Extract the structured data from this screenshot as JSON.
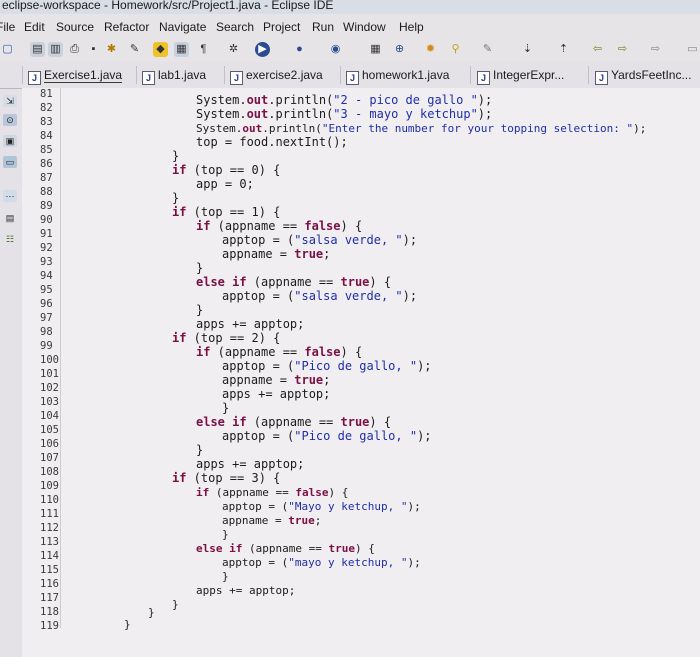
{
  "window": {
    "title": "eclipse-workspace - Homework/src/Project1.java - Eclipse IDE"
  },
  "menu": [
    "File",
    "Edit",
    "Source",
    "Refactor",
    "Navigate",
    "Search",
    "Project",
    "Run",
    "Window",
    "Help"
  ],
  "tabs": [
    {
      "label": "Exercise1.java"
    },
    {
      "label": "lab1.java"
    },
    {
      "label": "exercise2.java"
    },
    {
      "label": "homework1.java"
    },
    {
      "label": "IntegerExpr..."
    },
    {
      "label": "YardsFeetInc..."
    }
  ],
  "line_numbers": [
    "81",
    "82",
    "83",
    "84",
    "85",
    "86",
    "87",
    "88",
    "89",
    "90",
    "91",
    "92",
    "93",
    "94",
    "95",
    "96",
    "97",
    "98",
    "99",
    "100",
    "101",
    "102",
    "103",
    "104",
    "105",
    "106",
    "107",
    "108",
    "109",
    "110",
    "111",
    "112",
    "113",
    "114",
    "115",
    "116",
    "117",
    "118",
    "119"
  ],
  "code": {
    "l1a": "System.",
    "l1b": "out",
    "l1c": ".println(",
    "l1s": "\"2 - pico de gallo \"",
    "l1d": ");",
    "l2a": "System.",
    "l2b": "out",
    "l2c": ".println(",
    "l2s": "\"3 - mayo y ketchup\"",
    "l2d": ");",
    "l3a": "System.",
    "l3b": "out",
    "l3c": ".println(",
    "l3s": "\"Enter the number for your topping selection: \"",
    "l3d": ");",
    "l4": "top = food.nextInt();",
    "l5": "}",
    "l6k": "if",
    "l6": " (top == 0) {",
    "l7": "app = 0;",
    "l8": "}",
    "l9k": "if",
    "l9": " (top == 1) {",
    "l10k": "if",
    "l10": " (appname == ",
    "l10b": "false",
    "l10c": ") {",
    "l11a": "apptop = (",
    "l11s": "\"salsa verde, \"",
    "l11b": ");",
    "l12a": "appname = ",
    "l12b": "true",
    "l12c": ";",
    "l13": "}",
    "l14k": "else if",
    "l14": " (appname == ",
    "l14b": "true",
    "l14c": ") {",
    "l15a": "apptop = (",
    "l15s": "\"salsa verde, \"",
    "l15b": ");",
    "l16": "}",
    "l17": "apps += apptop;",
    "l18k": "if",
    "l18": " (top == 2) {",
    "l19k": "if",
    "l19": " (appname == ",
    "l19b": "false",
    "l19c": ") {",
    "l20a": "apptop = (",
    "l20s": "\"Pico de gallo, \"",
    "l20b": ");",
    "l21a": "appname = ",
    "l21b": "true",
    "l21c": ";",
    "l22": "apps += apptop;",
    "l23": "}",
    "l24k": "else if",
    "l24": " (appname == ",
    "l24b": "true",
    "l24c": ") {",
    "l25a": "apptop = (",
    "l25s": "\"Pico de gallo, \"",
    "l25b": ");",
    "l26": "}",
    "l27": "apps += apptop;",
    "l28k": "if",
    "l28": " (top == 3) {",
    "l29k": "if",
    "l29": " (appname == ",
    "l29b": "false",
    "l29c": ") {",
    "l30a": "apptop = (",
    "l30s": "\"Mayo y ketchup, \"",
    "l30b": ");",
    "l31a": "appname = ",
    "l31b": "true",
    "l31c": ";",
    "l32": "}",
    "l33k": "else if",
    "l33": " (appname == ",
    "l33b": "true",
    "l33c": ") {",
    "l34a": "apptop = (",
    "l34s": "\"mayo y ketchup, \"",
    "l34b": ");",
    "l35": "}",
    "l36": "apps += apptop;",
    "l37": "}",
    "l38": "}",
    "l39": "}"
  }
}
